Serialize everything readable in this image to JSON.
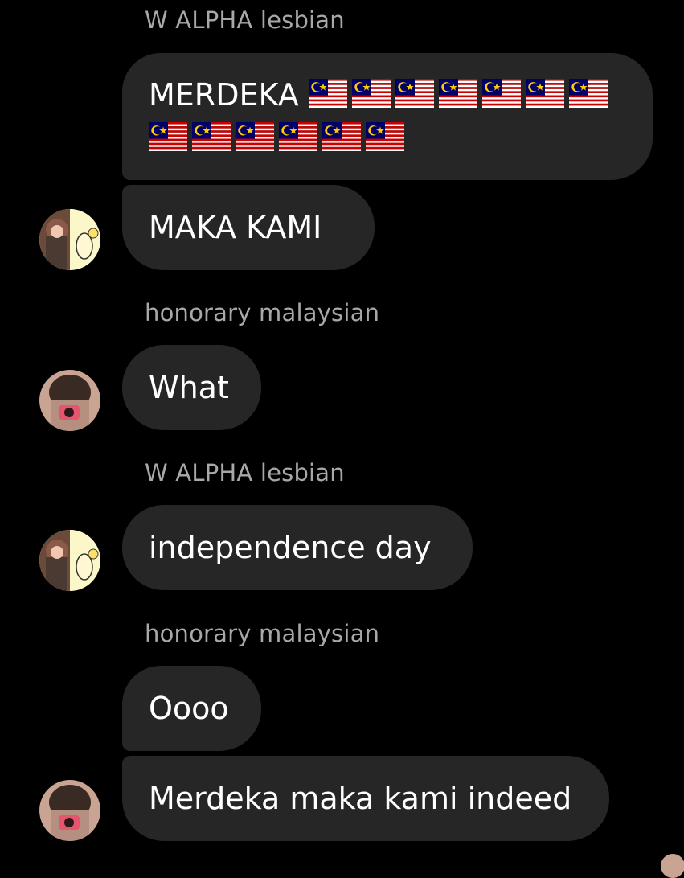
{
  "messages": [
    {
      "sender": "W ALPHA lesbian",
      "text_line1": "MERDEKA",
      "flags_line1": 7,
      "flags_line2": 6
    },
    {
      "text": "MAKA KAMI"
    },
    {
      "sender": "honorary malaysian",
      "text": "What"
    },
    {
      "sender": "W ALPHA lesbian",
      "text": "independence day"
    },
    {
      "sender": "honorary malaysian",
      "text": "Oooo"
    },
    {
      "text": "Merdeka maka kami indeed"
    }
  ],
  "flag_icon": "malaysia-flag-emoji",
  "colors": {
    "background": "#000000",
    "bubble": "#262626",
    "sender": "#a8a8a8",
    "text": "#ffffff"
  }
}
